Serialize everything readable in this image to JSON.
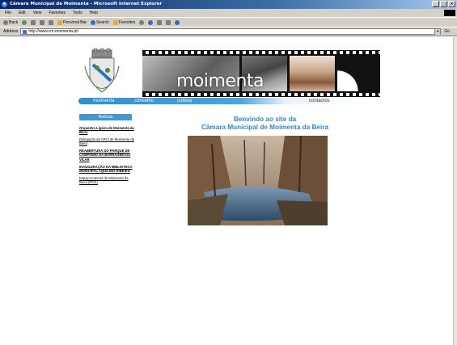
{
  "window": {
    "title": "Câmara Municipal de Moimenta - Microsoft Internet Explorer",
    "controls": [
      "_",
      "□",
      "×"
    ]
  },
  "menu": [
    "File",
    "Edit",
    "View",
    "Favorites",
    "Tools",
    "Help"
  ],
  "toolbar": {
    "back": "Back",
    "personal_bar": "Personal Bar",
    "search": "Search",
    "favorites": "Favorites"
  },
  "address": {
    "label": "Address",
    "url": "http://www.cm-moimenta.pt/",
    "go": "Go"
  },
  "banner": {
    "brand": "moimenta",
    "nav": [
      "moimenta",
      "concelho",
      "cultura",
      "contactos"
    ]
  },
  "sidebar": {
    "heading": "Notícias",
    "items": [
      {
        "text": "Orquestra Ligeira de Moimenta da Beira",
        "bold": true
      },
      {
        "text": "Delegação da ARCI de Moimenta da Beira",
        "bold": false
      },
      {
        "text": "REABERTURA DO PARQUE DE CAMPISMO DA BARRAGEM DO VILAR",
        "bold": true
      },
      {
        "text": "INAUGURAÇÃO DA BIBLIOTECA MUNICIPAL AQUILINO RIBEIRO",
        "bold": true
      },
      {
        "text": "Espaço Internet de Moimenta da Beira (PCG)",
        "bold": false
      }
    ]
  },
  "main": {
    "welcome_line1": "Benvindo ao site da",
    "welcome_line2": "Câmara Municipal de Moimenta da Beira"
  },
  "icons": {
    "ie": "ie-logo-icon",
    "windows": "windows-flag-icon"
  }
}
